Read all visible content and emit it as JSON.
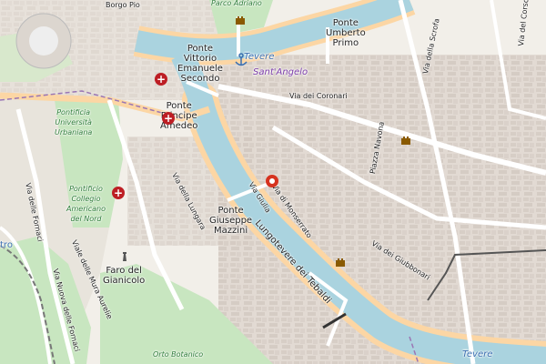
{
  "map": {
    "labels": {
      "borgo_pio": "Borgo Pio",
      "parco_adriano": "Parco Adriano",
      "ponte_umberto": "Ponte\nUmberto\nPrimo",
      "tevere_top": "Tevere",
      "sant_angelo": "Sant'Angelo",
      "ponte_vittorio": "Ponte\nVittorio\nEmanuele\nSecondo",
      "ponte_principe": "Ponte\nPrincipe\nAmedeo",
      "via_coronari": "Via dei Coronari",
      "piazza_navona": "Piazza Navona",
      "pontificia_urbaniana": "Pontificia\nUniversità\nUrbaniana",
      "pontificio_collegio": "Pontificio\nCollegio\nAmericano\ndel Nord",
      "via_fornaci": "Via delle Fornaci",
      "via_lungara": "Via della Lungara",
      "via_giulia": "Via Giulia",
      "via_monserrato": "Via di Monserrato",
      "ponte_mazzini": "Ponte\nGiuseppe\nMazzini",
      "lungotevere_tebaldi": "Lungotevere dei Tebaldi",
      "via_giubbonari": "Via dei Giubbonari",
      "faro": "Faro del\nGianicolo",
      "via_mura_aurelie": "Viale delle Mura Aurelie",
      "via_nuova_fornaci": "Via Nuova delle Fornaci",
      "orto_botanico": "Orto Botanico",
      "via_scrofa": "Via della Scrofa",
      "via_corso": "Via del Corso",
      "tevere_bottom": "Tevere",
      "tro": "tro"
    },
    "colors": {
      "land": "#f2efe9",
      "river": "#aad3df",
      "lungotevere": "#fcd6a4",
      "park": "#c8e6c0",
      "building": "#d9d0c9",
      "hospital": "#bd1e24",
      "marker": "#d6331f"
    },
    "icons": {
      "hospitals": [
        "hospital-icon",
        "hospital-icon",
        "hospital-icon"
      ],
      "marker": "location-marker-icon",
      "towers": [
        "castle-icon",
        "castle-icon",
        "castle-icon"
      ],
      "anchor": "anchor-icon",
      "lighthouse": "lighthouse-icon"
    }
  }
}
